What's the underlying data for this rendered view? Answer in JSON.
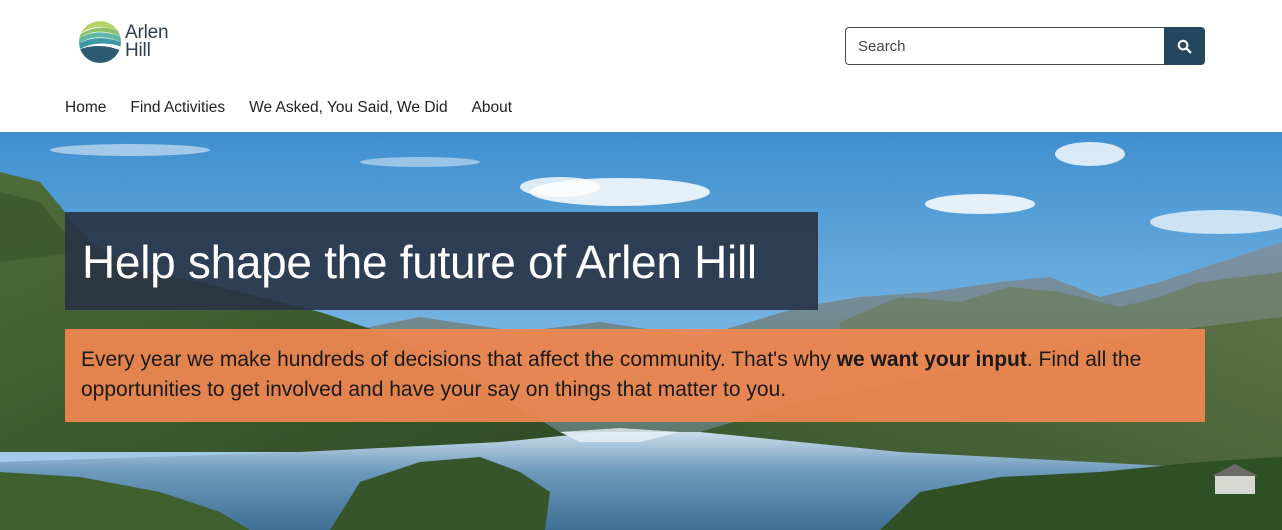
{
  "header": {
    "logo": {
      "line1": "Arlen",
      "line2": "Hill"
    },
    "search": {
      "placeholder": "Search"
    },
    "nav": [
      {
        "label": "Home"
      },
      {
        "label": "Find Activities"
      },
      {
        "label": "We Asked, You Said, We Did"
      },
      {
        "label": "About"
      }
    ]
  },
  "hero": {
    "title": "Help shape the future of Arlen Hill",
    "intro": {
      "before": "Every year we make hundreds of decisions that affect the community. That's why ",
      "emphasis": "we want your input",
      "after": ". Find all the opportunities to get involved and have your say on things that matter to you."
    },
    "colors": {
      "title_bg": "#283244",
      "intro_bg": "#f08750",
      "search_button": "#24475f"
    }
  },
  "icons": {
    "search": "search-icon",
    "logo": "hills-logo-icon"
  }
}
